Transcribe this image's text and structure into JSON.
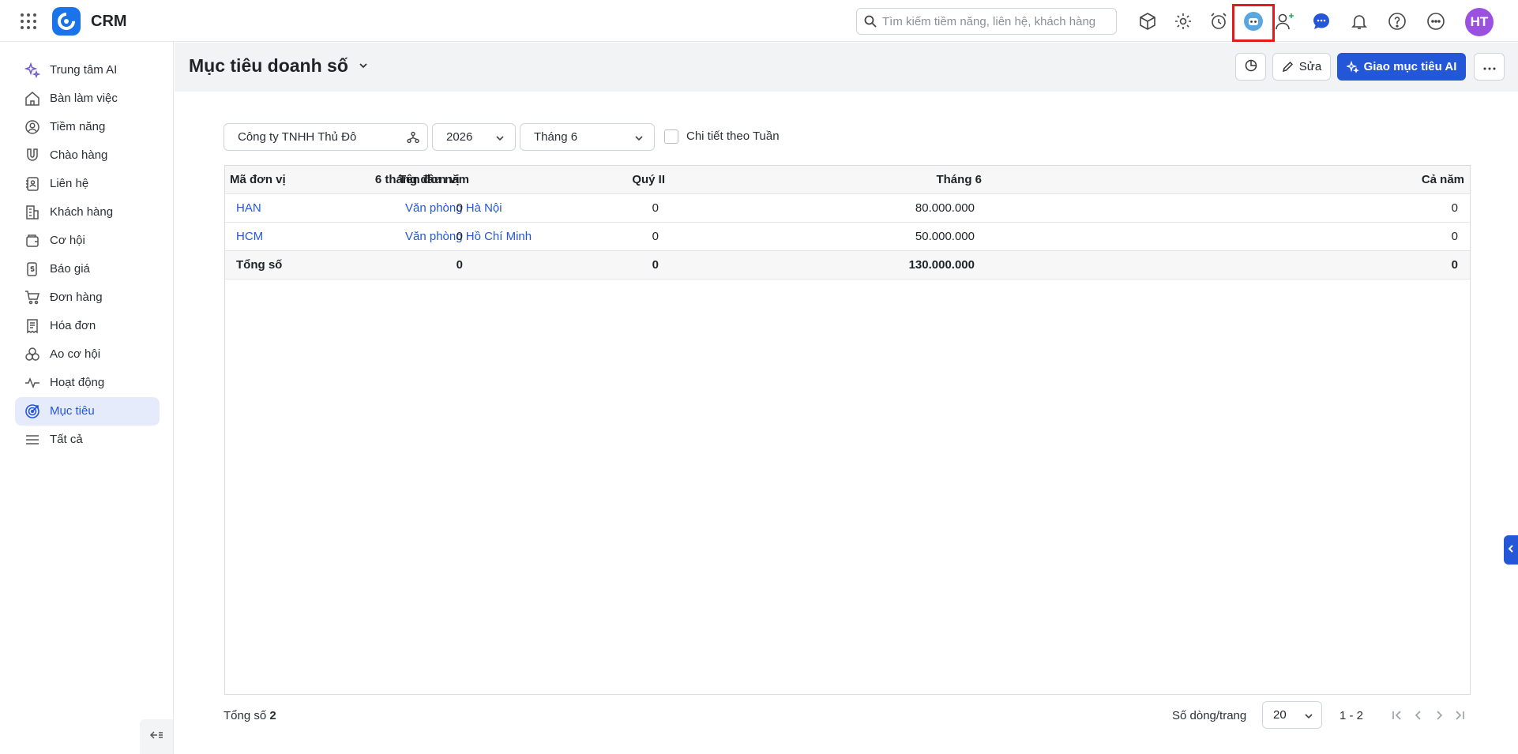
{
  "app": {
    "name": "CRM"
  },
  "search": {
    "placeholder": "Tìm kiếm tiềm năng, liên hệ, khách hàng"
  },
  "user": {
    "initials": "HT"
  },
  "colors": {
    "accent": "#2357d8",
    "avatar": "#9b51e0",
    "highlight": "#e31b1b"
  },
  "sidebar": {
    "items": [
      {
        "label": "Trung tâm AI",
        "icon": "sparkle-icon"
      },
      {
        "label": "Bàn làm việc",
        "icon": "home-icon"
      },
      {
        "label": "Tiềm năng",
        "icon": "user-circle-icon"
      },
      {
        "label": "Chào hàng",
        "icon": "magnet-icon"
      },
      {
        "label": "Liên hệ",
        "icon": "contact-book-icon"
      },
      {
        "label": "Khách hàng",
        "icon": "building-icon"
      },
      {
        "label": "Cơ hội",
        "icon": "wallet-icon"
      },
      {
        "label": "Báo giá",
        "icon": "quote-icon"
      },
      {
        "label": "Đơn hàng",
        "icon": "cart-icon"
      },
      {
        "label": "Hóa đơn",
        "icon": "receipt-icon"
      },
      {
        "label": "Ao cơ hội",
        "icon": "circles-icon"
      },
      {
        "label": "Hoạt động",
        "icon": "activity-icon"
      },
      {
        "label": "Mục tiêu",
        "icon": "target-icon",
        "active": true
      },
      {
        "label": "Tất cả",
        "icon": "menu-icon"
      }
    ]
  },
  "header": {
    "title": "Mục tiêu doanh số",
    "edit_label": "Sửa",
    "ai_label": "Giao mục tiêu AI"
  },
  "filters": {
    "company": "Công ty TNHH Thủ Đô",
    "year": "2026",
    "month": "Tháng 6",
    "weekly_detail_label": "Chi tiết theo Tuần",
    "weekly_detail_checked": false
  },
  "table": {
    "columns": [
      "Mã đơn vị",
      "Tên đơn vị",
      "Tháng 6",
      "Quý II",
      "6 tháng đầu năm",
      "Cả năm"
    ],
    "rows": [
      [
        "HAN",
        "Văn phòng Hà Nội",
        "80.000.000",
        "0",
        "0",
        "0"
      ],
      [
        "HCM",
        "Văn phòng Hồ Chí Minh",
        "50.000.000",
        "0",
        "0",
        "0"
      ]
    ],
    "total": [
      "Tổng số",
      "",
      "130.000.000",
      "0",
      "0",
      "0"
    ]
  },
  "footer": {
    "total_label": "Tổng số",
    "total_count": "2",
    "rows_per_page_label": "Số dòng/trang",
    "rows_per_page": "20",
    "range": "1 - 2"
  }
}
